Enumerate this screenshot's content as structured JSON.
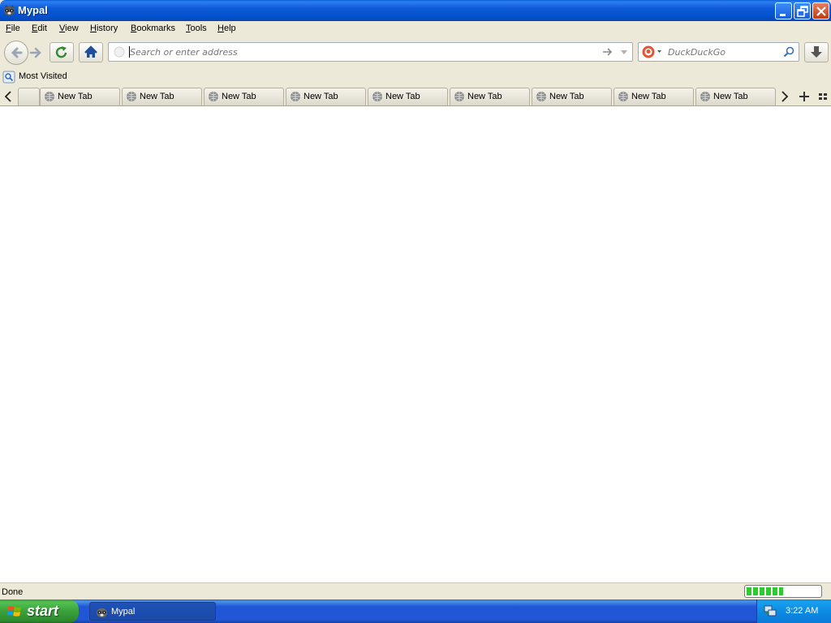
{
  "window": {
    "title": "Mypal",
    "minimize_icon": "minimize-icon",
    "restore_icon": "restore-icon",
    "close_icon": "close-icon"
  },
  "menu": {
    "items": [
      {
        "label": "File"
      },
      {
        "label": "Edit"
      },
      {
        "label": "View"
      },
      {
        "label": "History"
      },
      {
        "label": "Bookmarks"
      },
      {
        "label": "Tools"
      },
      {
        "label": "Help"
      }
    ]
  },
  "toolbar": {
    "back_icon": "back-arrow-icon",
    "forward_icon": "forward-arrow-icon",
    "reload_icon": "reload-icon",
    "home_icon": "home-icon",
    "download_icon": "download-icon",
    "url": {
      "value": "",
      "placeholder": "Search or enter address"
    },
    "search": {
      "engine": "DuckDuckGo",
      "value": "",
      "placeholder": "DuckDuckGo"
    }
  },
  "bookmarks": {
    "items": [
      {
        "label": "Most Visited",
        "icon": "most-visited-icon"
      }
    ]
  },
  "tabs": {
    "items": [
      {
        "label": "New Tab"
      },
      {
        "label": "New Tab"
      },
      {
        "label": "New Tab"
      },
      {
        "label": "New Tab"
      },
      {
        "label": "New Tab"
      },
      {
        "label": "New Tab"
      },
      {
        "label": "New Tab"
      },
      {
        "label": "New Tab"
      },
      {
        "label": "New Tab"
      }
    ]
  },
  "status": {
    "text": "Done",
    "progress_fraction": 0.5
  },
  "taskbar": {
    "start_label": "start",
    "task_label": "Mypal",
    "clock": "3:22 AM"
  },
  "colors": {
    "titlebar": "#0553d0",
    "chrome": "#ece9d8",
    "taskbar": "#2157d7",
    "start": "#3aa13a",
    "progress": "#2ecb2e"
  }
}
